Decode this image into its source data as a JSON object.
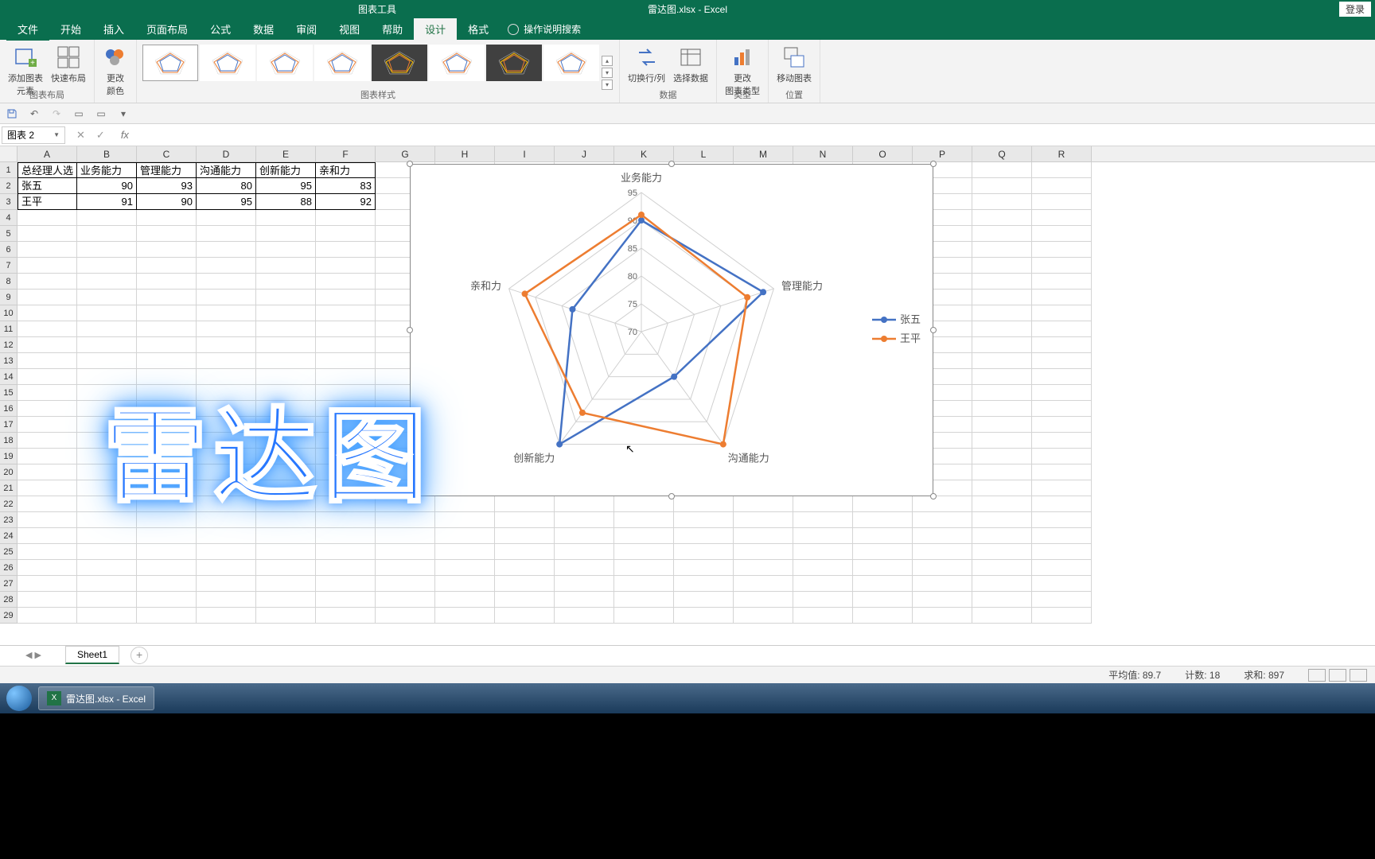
{
  "titlebar": {
    "chart_tools": "图表工具",
    "doc_title": "雷达图.xlsx - Excel",
    "login": "登录"
  },
  "tabs": {
    "file": "文件",
    "home": "开始",
    "insert": "插入",
    "layout": "页面布局",
    "formulas": "公式",
    "data": "数据",
    "review": "审阅",
    "view": "视图",
    "help": "帮助",
    "design": "设计",
    "format": "格式",
    "tellme": "操作说明搜索"
  },
  "ribbon": {
    "add_element": "添加图表\n元素",
    "quick_layout": "快速布局",
    "layout_group": "图表布局",
    "change_color": "更改\n颜色",
    "styles_group": "图表样式",
    "switch_rc": "切换行/列",
    "select_data": "选择数据",
    "data_group": "数据",
    "change_type": "更改\n图表类型",
    "type_group": "类型",
    "move_chart": "移动图表",
    "location_group": "位置"
  },
  "namebox": "图表 2",
  "columns": [
    "A",
    "B",
    "C",
    "D",
    "E",
    "F",
    "G",
    "H",
    "I",
    "J",
    "K",
    "L",
    "M",
    "N",
    "O",
    "P",
    "Q",
    "R"
  ],
  "table": {
    "header": [
      "总经理人选",
      "业务能力",
      "管理能力",
      "沟通能力",
      "创新能力",
      "亲和力"
    ],
    "rows": [
      [
        "张五",
        90,
        93,
        80,
        95,
        83
      ],
      [
        "王平",
        91,
        90,
        95,
        88,
        92
      ]
    ]
  },
  "chart_data": {
    "type": "radar",
    "categories": [
      "业务能力",
      "管理能力",
      "沟通能力",
      "创新能力",
      "亲和力"
    ],
    "series": [
      {
        "name": "张五",
        "values": [
          90,
          93,
          80,
          95,
          83
        ],
        "color": "#4472C4"
      },
      {
        "name": "王平",
        "values": [
          91,
          90,
          95,
          88,
          92
        ],
        "color": "#ED7D31"
      }
    ],
    "axis_ticks": [
      70,
      75,
      80,
      85,
      90,
      95
    ],
    "rmin": 70,
    "rmax": 95
  },
  "big_text": "雷达图",
  "sheet": "Sheet1",
  "status": {
    "avg_label": "平均值:",
    "avg": "89.7",
    "count_label": "计数:",
    "count": "18",
    "sum_label": "求和:",
    "sum": "897"
  },
  "taskbar_item": "雷达图.xlsx - Excel"
}
